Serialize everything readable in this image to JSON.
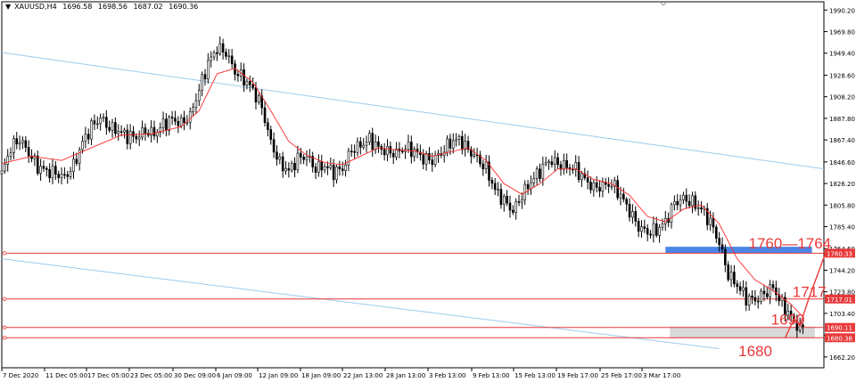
{
  "header": {
    "symbol": "XAUUSD,H4",
    "open": "1696.58",
    "high": "1698.56",
    "low": "1687.02",
    "close": "1690.36",
    "collapse_glyph": "triangle-down-icon"
  },
  "colors": {
    "background": "#ffffff",
    "frame": "#000000",
    "candle": "#000000",
    "moving_average": "#ff2a2a",
    "horizontal_lines": "#e8393a",
    "channel_lines": "#9ccbec",
    "resistance_zone": "#4a86e8",
    "support_zone": "#d9d9d9",
    "annotation": "#e8393a",
    "price_badge": "#e8393a",
    "axis_text": "#000000"
  },
  "chart_data": {
    "type": "candlestick",
    "y_ticks": [
      1990.2,
      1969.8,
      1949.4,
      1928.6,
      1908.2,
      1887.8,
      1867.4,
      1846.6,
      1826.2,
      1805.8,
      1785.4,
      1764.6,
      1744.2,
      1723.8,
      1703.4,
      1682.6,
      1662.2
    ],
    "y_tick_labels": [
      "1990.20",
      "1969.80",
      "1949.40",
      "1928.60",
      "1908.20",
      "1887.80",
      "1867.40",
      "1846.60",
      "1826.20",
      "1805.80",
      "1785.40",
      "1764.60",
      "1744.20",
      "1723.80",
      "1703.40",
      "1682.60",
      "1662.20"
    ],
    "x_tick_labels": [
      "7 Dec 2020",
      "11 Dec 05:00",
      "17 Dec 05:00",
      "23 Dec 05:00",
      "30 Dec 09:00",
      "6 Jan 09:00",
      "12 Jan 09:00",
      "18 Jan 09:00",
      "22 Jan 13:00",
      "28 Jan 13:00",
      "3 Feb 13:00",
      "9 Feb 13:00",
      "15 Feb 13:00",
      "19 Feb 17:00",
      "25 Feb 17:00",
      "3 Mar 17:00"
    ],
    "ylim": [
      1652,
      1998
    ],
    "close_path": [
      [
        0,
        1835
      ],
      [
        3,
        1860
      ],
      [
        6,
        1868
      ],
      [
        9,
        1855
      ],
      [
        12,
        1842
      ],
      [
        15,
        1838
      ],
      [
        18,
        1836
      ],
      [
        21,
        1832
      ],
      [
        24,
        1843
      ],
      [
        27,
        1865
      ],
      [
        30,
        1880
      ],
      [
        33,
        1888
      ],
      [
        36,
        1879
      ],
      [
        39,
        1876
      ],
      [
        42,
        1871
      ],
      [
        45,
        1870
      ],
      [
        48,
        1876
      ],
      [
        51,
        1873
      ],
      [
        54,
        1882
      ],
      [
        57,
        1887
      ],
      [
        60,
        1883
      ],
      [
        63,
        1890
      ],
      [
        66,
        1915
      ],
      [
        69,
        1940
      ],
      [
        72,
        1954
      ],
      [
        75,
        1950
      ],
      [
        78,
        1932
      ],
      [
        81,
        1925
      ],
      [
        84,
        1915
      ],
      [
        87,
        1898
      ],
      [
        90,
        1865
      ],
      [
        93,
        1845
      ],
      [
        96,
        1838
      ],
      [
        99,
        1850
      ],
      [
        102,
        1852
      ],
      [
        105,
        1840
      ],
      [
        108,
        1843
      ],
      [
        111,
        1837
      ],
      [
        114,
        1840
      ],
      [
        117,
        1858
      ],
      [
        120,
        1862
      ],
      [
        123,
        1868
      ],
      [
        126,
        1860
      ],
      [
        129,
        1856
      ],
      [
        132,
        1855
      ],
      [
        135,
        1860
      ],
      [
        138,
        1857
      ],
      [
        141,
        1850
      ],
      [
        144,
        1848
      ],
      [
        147,
        1855
      ],
      [
        150,
        1865
      ],
      [
        153,
        1868
      ],
      [
        156,
        1858
      ],
      [
        159,
        1850
      ],
      [
        162,
        1840
      ],
      [
        165,
        1820
      ],
      [
        168,
        1810
      ],
      [
        171,
        1800
      ],
      [
        174,
        1815
      ],
      [
        177,
        1828
      ],
      [
        180,
        1838
      ],
      [
        183,
        1848
      ],
      [
        186,
        1845
      ],
      [
        189,
        1842
      ],
      [
        192,
        1840
      ],
      [
        195,
        1830
      ],
      [
        198,
        1822
      ],
      [
        201,
        1824
      ],
      [
        204,
        1826
      ],
      [
        207,
        1815
      ],
      [
        210,
        1800
      ],
      [
        213,
        1785
      ],
      [
        216,
        1780
      ],
      [
        219,
        1782
      ],
      [
        222,
        1790
      ],
      [
        225,
        1808
      ],
      [
        228,
        1812
      ],
      [
        231,
        1808
      ],
      [
        234,
        1802
      ],
      [
        237,
        1790
      ],
      [
        240,
        1770
      ],
      [
        243,
        1740
      ],
      [
        246,
        1730
      ],
      [
        249,
        1718
      ],
      [
        252,
        1716
      ],
      [
        255,
        1722
      ],
      [
        258,
        1728
      ],
      [
        261,
        1712
      ],
      [
        264,
        1700
      ],
      [
        267,
        1688
      ],
      [
        268,
        1690.36
      ]
    ],
    "moving_average_path": [
      [
        0,
        1845
      ],
      [
        10,
        1852
      ],
      [
        20,
        1848
      ],
      [
        30,
        1860
      ],
      [
        40,
        1872
      ],
      [
        50,
        1873
      ],
      [
        60,
        1880
      ],
      [
        66,
        1895
      ],
      [
        72,
        1930
      ],
      [
        78,
        1935
      ],
      [
        84,
        1922
      ],
      [
        90,
        1895
      ],
      [
        96,
        1866
      ],
      [
        102,
        1853
      ],
      [
        108,
        1846
      ],
      [
        114,
        1844
      ],
      [
        120,
        1852
      ],
      [
        126,
        1860
      ],
      [
        132,
        1858
      ],
      [
        138,
        1857
      ],
      [
        144,
        1852
      ],
      [
        150,
        1856
      ],
      [
        156,
        1860
      ],
      [
        162,
        1848
      ],
      [
        168,
        1826
      ],
      [
        174,
        1816
      ],
      [
        180,
        1826
      ],
      [
        186,
        1840
      ],
      [
        192,
        1840
      ],
      [
        198,
        1830
      ],
      [
        204,
        1826
      ],
      [
        210,
        1815
      ],
      [
        216,
        1795
      ],
      [
        222,
        1790
      ],
      [
        228,
        1802
      ],
      [
        234,
        1806
      ],
      [
        240,
        1788
      ],
      [
        246,
        1755
      ],
      [
        252,
        1735
      ],
      [
        258,
        1725
      ],
      [
        264,
        1712
      ],
      [
        268,
        1700
      ]
    ],
    "horizontal_levels": [
      {
        "value": 1760.33,
        "label": "1760.33"
      },
      {
        "value": 1717.01,
        "label": "1717.01"
      },
      {
        "value": 1690.11,
        "label": "1690.11"
      },
      {
        "value": 1680.38,
        "label": "1680.38"
      }
    ],
    "zones": [
      {
        "name": "resistance",
        "from": 1760.3,
        "to": 1766.4
      },
      {
        "name": "support",
        "from": 1679.8,
        "to": 1691.0
      }
    ],
    "channel_lines": [
      {
        "from": [
          0,
          1950.0
        ],
        "to": [
          275,
          1840.0
        ]
      },
      {
        "from": [
          0,
          1755.0
        ],
        "to": [
          240,
          1670.0
        ]
      }
    ],
    "annotations": [
      {
        "text": "1760—1764",
        "value": 1770
      },
      {
        "text": "1717",
        "value": 1724
      },
      {
        "text": "1690",
        "value": 1698
      },
      {
        "text": "1680",
        "value": 1668
      }
    ],
    "projection_path": [
      [
        262,
        1680
      ],
      [
        265,
        1698
      ],
      [
        267,
        1692
      ],
      [
        270,
        1718
      ],
      [
        276,
        1764
      ]
    ]
  }
}
